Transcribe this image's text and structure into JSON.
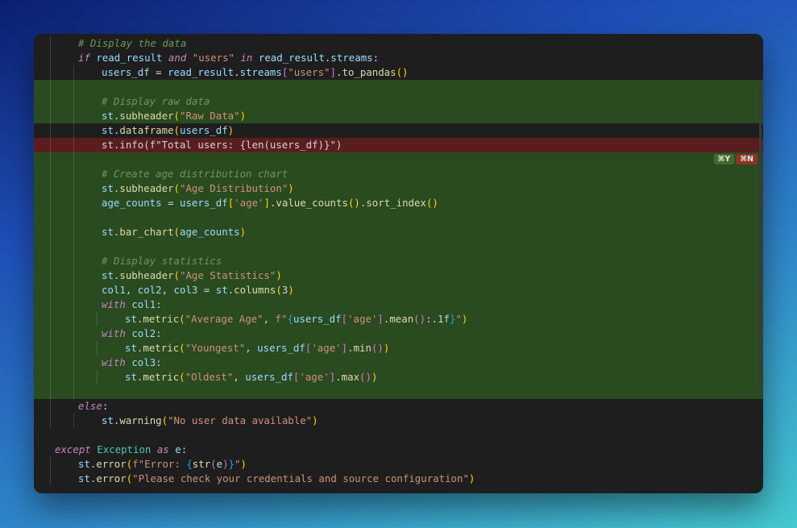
{
  "editor": {
    "lines": [
      {
        "indent": 1,
        "state": "normal",
        "tokens": [
          [
            "cm",
            "# Display the data"
          ]
        ]
      },
      {
        "indent": 1,
        "state": "normal",
        "tokens": [
          [
            "kw",
            "if"
          ],
          [
            "op",
            " "
          ],
          [
            "id",
            "read_result"
          ],
          [
            "op",
            " "
          ],
          [
            "kw",
            "and"
          ],
          [
            "op",
            " "
          ],
          [
            "st",
            "\"users\""
          ],
          [
            "op",
            " "
          ],
          [
            "kw",
            "in"
          ],
          [
            "op",
            " "
          ],
          [
            "id",
            "read_result"
          ],
          [
            "op",
            "."
          ],
          [
            "id",
            "streams"
          ],
          [
            "op",
            ":"
          ]
        ]
      },
      {
        "indent": 2,
        "state": "normal",
        "tokens": [
          [
            "id",
            "users_df"
          ],
          [
            "op",
            " = "
          ],
          [
            "id",
            "read_result"
          ],
          [
            "op",
            "."
          ],
          [
            "id",
            "streams"
          ],
          [
            "pr2",
            "["
          ],
          [
            "st",
            "\"users\""
          ],
          [
            "pr2",
            "]"
          ],
          [
            "op",
            "."
          ],
          [
            "fn",
            "to_pandas"
          ],
          [
            "pr",
            "()"
          ]
        ]
      },
      {
        "indent": 2,
        "state": "added",
        "tokens": []
      },
      {
        "indent": 2,
        "state": "added",
        "tokens": [
          [
            "cm",
            "# Display raw data"
          ]
        ]
      },
      {
        "indent": 2,
        "state": "added",
        "tokens": [
          [
            "id",
            "st"
          ],
          [
            "op",
            "."
          ],
          [
            "fn",
            "subheader"
          ],
          [
            "pr",
            "("
          ],
          [
            "st",
            "\"Raw Data\""
          ],
          [
            "pr",
            ")"
          ]
        ]
      },
      {
        "indent": 2,
        "state": "normal",
        "tokens": [
          [
            "id",
            "st"
          ],
          [
            "op",
            "."
          ],
          [
            "fn",
            "dataframe"
          ],
          [
            "pr",
            "("
          ],
          [
            "id",
            "users_df"
          ],
          [
            "pr",
            ")"
          ]
        ]
      },
      {
        "indent": 2,
        "state": "removed",
        "tokens": [
          [
            "op",
            "st.info(f\"Total users: {len(users_df)}\")"
          ]
        ]
      },
      {
        "indent": 2,
        "state": "added",
        "badges": true,
        "tokens": []
      },
      {
        "indent": 2,
        "state": "added",
        "tokens": [
          [
            "cm",
            "# Create age distribution chart"
          ]
        ]
      },
      {
        "indent": 2,
        "state": "added",
        "tokens": [
          [
            "id",
            "st"
          ],
          [
            "op",
            "."
          ],
          [
            "fn",
            "subheader"
          ],
          [
            "pr",
            "("
          ],
          [
            "st",
            "\"Age Distribution\""
          ],
          [
            "pr",
            ")"
          ]
        ]
      },
      {
        "indent": 2,
        "state": "added",
        "tokens": [
          [
            "id",
            "age_counts"
          ],
          [
            "op",
            " = "
          ],
          [
            "id",
            "users_df"
          ],
          [
            "pr",
            "["
          ],
          [
            "st",
            "'age'"
          ],
          [
            "pr",
            "]"
          ],
          [
            "op",
            "."
          ],
          [
            "fn",
            "value_counts"
          ],
          [
            "pr",
            "()"
          ],
          [
            "op",
            "."
          ],
          [
            "fn",
            "sort_index"
          ],
          [
            "pr",
            "()"
          ]
        ]
      },
      {
        "indent": 2,
        "state": "added",
        "tokens": []
      },
      {
        "indent": 2,
        "state": "added",
        "tokens": [
          [
            "id",
            "st"
          ],
          [
            "op",
            "."
          ],
          [
            "fn",
            "bar_chart"
          ],
          [
            "pr",
            "("
          ],
          [
            "id",
            "age_counts"
          ],
          [
            "pr",
            ")"
          ]
        ]
      },
      {
        "indent": 2,
        "state": "added",
        "tokens": []
      },
      {
        "indent": 2,
        "state": "added",
        "tokens": [
          [
            "cm",
            "# Display statistics"
          ]
        ]
      },
      {
        "indent": 2,
        "state": "added",
        "tokens": [
          [
            "id",
            "st"
          ],
          [
            "op",
            "."
          ],
          [
            "fn",
            "subheader"
          ],
          [
            "pr",
            "("
          ],
          [
            "st",
            "\"Age Statistics\""
          ],
          [
            "pr",
            ")"
          ]
        ]
      },
      {
        "indent": 2,
        "state": "added",
        "tokens": [
          [
            "id",
            "col1"
          ],
          [
            "op",
            ", "
          ],
          [
            "id",
            "col2"
          ],
          [
            "op",
            ", "
          ],
          [
            "id",
            "col3"
          ],
          [
            "op",
            " = "
          ],
          [
            "id",
            "st"
          ],
          [
            "op",
            "."
          ],
          [
            "fn",
            "columns"
          ],
          [
            "pr",
            "("
          ],
          [
            "op",
            "3"
          ],
          [
            "pr",
            ")"
          ]
        ]
      },
      {
        "indent": 2,
        "state": "added",
        "tokens": [
          [
            "kw",
            "with"
          ],
          [
            "op",
            " "
          ],
          [
            "id",
            "col1"
          ],
          [
            "op",
            ":"
          ]
        ]
      },
      {
        "indent": 3,
        "state": "added",
        "tokens": [
          [
            "id",
            "st"
          ],
          [
            "op",
            "."
          ],
          [
            "fn",
            "metric"
          ],
          [
            "pr",
            "("
          ],
          [
            "st",
            "\"Average Age\""
          ],
          [
            "op",
            ", "
          ],
          [
            "st",
            "f\""
          ],
          [
            "pr3",
            "{"
          ],
          [
            "id",
            "users_df"
          ],
          [
            "pr2",
            "["
          ],
          [
            "st",
            "'age'"
          ],
          [
            "pr2",
            "]"
          ],
          [
            "op",
            "."
          ],
          [
            "fn",
            "mean"
          ],
          [
            "pr2",
            "()"
          ],
          [
            "op",
            ":.1f"
          ],
          [
            "pr3",
            "}"
          ],
          [
            "st",
            "\""
          ],
          [
            "pr",
            ")"
          ]
        ]
      },
      {
        "indent": 2,
        "state": "added",
        "tokens": [
          [
            "kw",
            "with"
          ],
          [
            "op",
            " "
          ],
          [
            "id",
            "col2"
          ],
          [
            "op",
            ":"
          ]
        ]
      },
      {
        "indent": 3,
        "state": "added",
        "tokens": [
          [
            "id",
            "st"
          ],
          [
            "op",
            "."
          ],
          [
            "fn",
            "metric"
          ],
          [
            "pr",
            "("
          ],
          [
            "st",
            "\"Youngest\""
          ],
          [
            "op",
            ", "
          ],
          [
            "id",
            "users_df"
          ],
          [
            "pr2",
            "["
          ],
          [
            "st",
            "'age'"
          ],
          [
            "pr2",
            "]"
          ],
          [
            "op",
            "."
          ],
          [
            "fn",
            "min"
          ],
          [
            "pr2",
            "()"
          ],
          [
            "pr",
            ")"
          ]
        ]
      },
      {
        "indent": 2,
        "state": "added",
        "tokens": [
          [
            "kw",
            "with"
          ],
          [
            "op",
            " "
          ],
          [
            "id",
            "col3"
          ],
          [
            "op",
            ":"
          ]
        ]
      },
      {
        "indent": 3,
        "state": "added",
        "tokens": [
          [
            "id",
            "st"
          ],
          [
            "op",
            "."
          ],
          [
            "fn",
            "metric"
          ],
          [
            "pr",
            "("
          ],
          [
            "st",
            "\"Oldest\""
          ],
          [
            "op",
            ", "
          ],
          [
            "id",
            "users_df"
          ],
          [
            "pr2",
            "["
          ],
          [
            "st",
            "'age'"
          ],
          [
            "pr2",
            "]"
          ],
          [
            "op",
            "."
          ],
          [
            "fn",
            "max"
          ],
          [
            "pr2",
            "()"
          ],
          [
            "pr",
            ")"
          ]
        ]
      },
      {
        "indent": 2,
        "state": "added",
        "tokens": []
      },
      {
        "indent": 1,
        "state": "normal",
        "tokens": [
          [
            "kw",
            "else"
          ],
          [
            "op",
            ":"
          ]
        ]
      },
      {
        "indent": 2,
        "state": "normal",
        "tokens": [
          [
            "id",
            "st"
          ],
          [
            "op",
            "."
          ],
          [
            "fn",
            "warning"
          ],
          [
            "pr",
            "("
          ],
          [
            "st",
            "\"No user data available\""
          ],
          [
            "pr",
            ")"
          ]
        ]
      },
      {
        "indent": 0,
        "state": "normal",
        "tokens": []
      },
      {
        "indent": 0,
        "state": "normal",
        "tokens": [
          [
            "kw",
            "except"
          ],
          [
            "op",
            " "
          ],
          [
            "cl",
            "Exception"
          ],
          [
            "op",
            " "
          ],
          [
            "kw",
            "as"
          ],
          [
            "op",
            " "
          ],
          [
            "id",
            "e"
          ],
          [
            "op",
            ":"
          ]
        ]
      },
      {
        "indent": 1,
        "state": "normal",
        "tokens": [
          [
            "id",
            "st"
          ],
          [
            "op",
            "."
          ],
          [
            "fn",
            "error"
          ],
          [
            "pr",
            "("
          ],
          [
            "st",
            "f\"Error: "
          ],
          [
            "pr3",
            "{"
          ],
          [
            "fn",
            "str"
          ],
          [
            "pr2",
            "("
          ],
          [
            "id",
            "e"
          ],
          [
            "pr2",
            ")"
          ],
          [
            "pr3",
            "}"
          ],
          [
            "st",
            "\""
          ],
          [
            "pr",
            ")"
          ]
        ]
      },
      {
        "indent": 1,
        "state": "normal",
        "tokens": [
          [
            "id",
            "st"
          ],
          [
            "op",
            "."
          ],
          [
            "fn",
            "error"
          ],
          [
            "pr",
            "("
          ],
          [
            "st",
            "\"Please check your credentials and source configuration\""
          ],
          [
            "pr",
            ")"
          ]
        ]
      }
    ],
    "accept_label": "⌘Y",
    "reject_label": "⌘N"
  }
}
